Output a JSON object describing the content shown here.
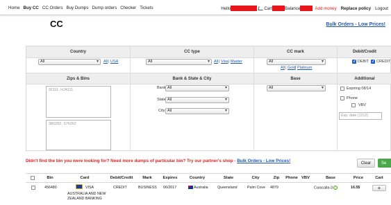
{
  "nav": {
    "items": [
      "Home",
      "Buy CC",
      "CC Orders",
      "Buy Dumps",
      "Dump orders",
      "Checker",
      "Tickets"
    ],
    "active_index": 1,
    "hello_label": "Hello",
    "cart_label": "Cart",
    "balance_label": "Balance",
    "add_money": "Add money",
    "replace_policy": "Replace policy",
    "logout": "Logout",
    "redacted_color": "#e8161b"
  },
  "page": {
    "title": "CC",
    "bulk_orders_link": "Bulk Orders - Low Prices!"
  },
  "filters": {
    "headers": {
      "country": "Country",
      "cc_type": "CC type",
      "cc_mark": "CC mark",
      "debit_credit": "Debit/Credit",
      "zips_bins": "Zips & Bins",
      "bank_state_city": "Bank & State & City",
      "base": "Base",
      "additional": "Additional"
    },
    "country": {
      "value": "All",
      "links": [
        "All",
        "USA"
      ]
    },
    "cc_type": {
      "value": "All",
      "links": [
        "All",
        "Visa",
        "Master"
      ]
    },
    "cc_mark": {
      "value": "All",
      "links": [
        "All",
        "Gold",
        "Platinum"
      ]
    },
    "debit_credit": {
      "debit_label": "DEBIT",
      "credit_label": "CREDIT",
      "debit_checked": true,
      "credit_checked": true
    },
    "zips_placeholder": "91111, HJ4111",
    "bins_placeholder": "380282, 376262",
    "bank": {
      "label": "Bank:",
      "value": "All"
    },
    "state": {
      "label": "State:",
      "value": "All"
    },
    "city": {
      "label": "City:",
      "value": "All"
    },
    "base": {
      "value": "All"
    },
    "additional": {
      "expiring_label": "Expiring 08/14",
      "phone_label": "Phone",
      "vbv_label": "VBV",
      "exp_placeholder": "Exp. date (1312)"
    }
  },
  "notice": {
    "text": "Didn't find the bin you were looking for? Need more dumps of particular bin? Try our partner's shop - ",
    "link": "Bulk Orders - Low Prices!"
  },
  "buttons": {
    "clear": "Clear",
    "search": "Se"
  },
  "results": {
    "headers": [
      "",
      "Bin",
      "Card",
      "Debit/Credit",
      "Mark",
      "Expires",
      "Country",
      "State",
      "City",
      "Zip",
      "Phone",
      "VBV",
      "Base",
      "Price",
      "Cart"
    ],
    "rows": [
      {
        "bin": "456480",
        "card_brand": "VISA",
        "card_bank_line1": "AUSTRALIA AND NEW",
        "card_bank_line2": "ZEALAND BANKING",
        "debit_credit": "CREDIT",
        "mark": "BUSINESS",
        "expires": "06/2017",
        "country": "Australia",
        "state": "Queensland",
        "city": "Palm Cove",
        "zip": "4879",
        "phone": "",
        "vbv": "",
        "base": "Caracalla-3",
        "price": "16.5$",
        "cart_button": "+"
      }
    ]
  }
}
